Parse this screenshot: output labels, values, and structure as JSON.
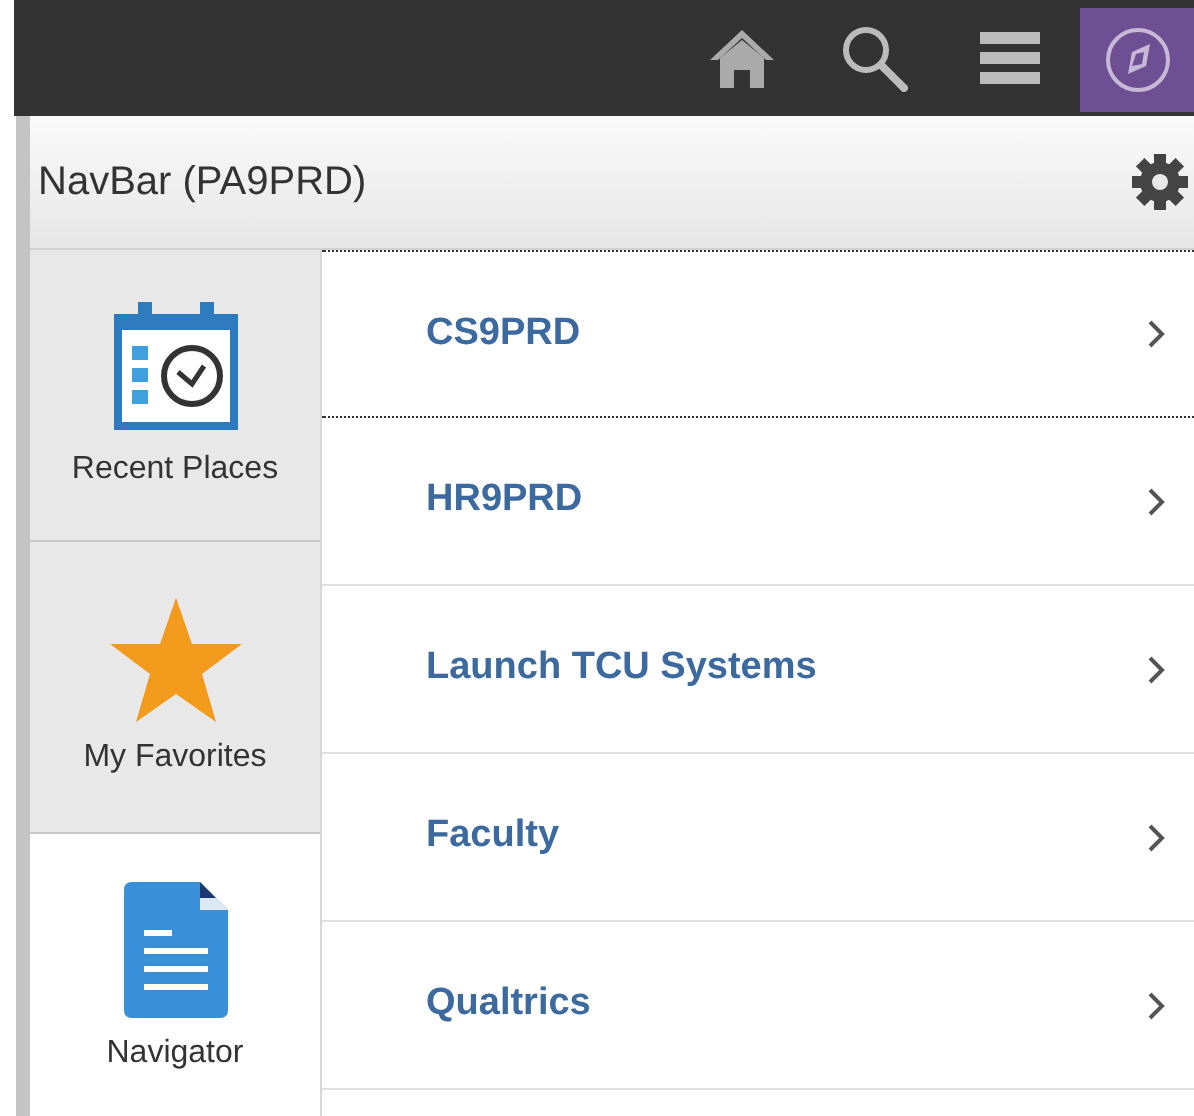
{
  "header": {
    "title": "NavBar (PA9PRD)"
  },
  "tabs": [
    {
      "label": "Recent Places",
      "kind": "recent",
      "selected": false
    },
    {
      "label": "My Favorites",
      "kind": "favorites",
      "selected": false
    },
    {
      "label": "Navigator",
      "kind": "navigator",
      "selected": true
    }
  ],
  "items": [
    {
      "label": "CS9PRD",
      "focused": true
    },
    {
      "label": "HR9PRD",
      "focused": false
    },
    {
      "label": "Launch TCU Systems",
      "focused": false
    },
    {
      "label": "Faculty",
      "focused": false
    },
    {
      "label": "Qualtrics",
      "focused": false
    }
  ]
}
